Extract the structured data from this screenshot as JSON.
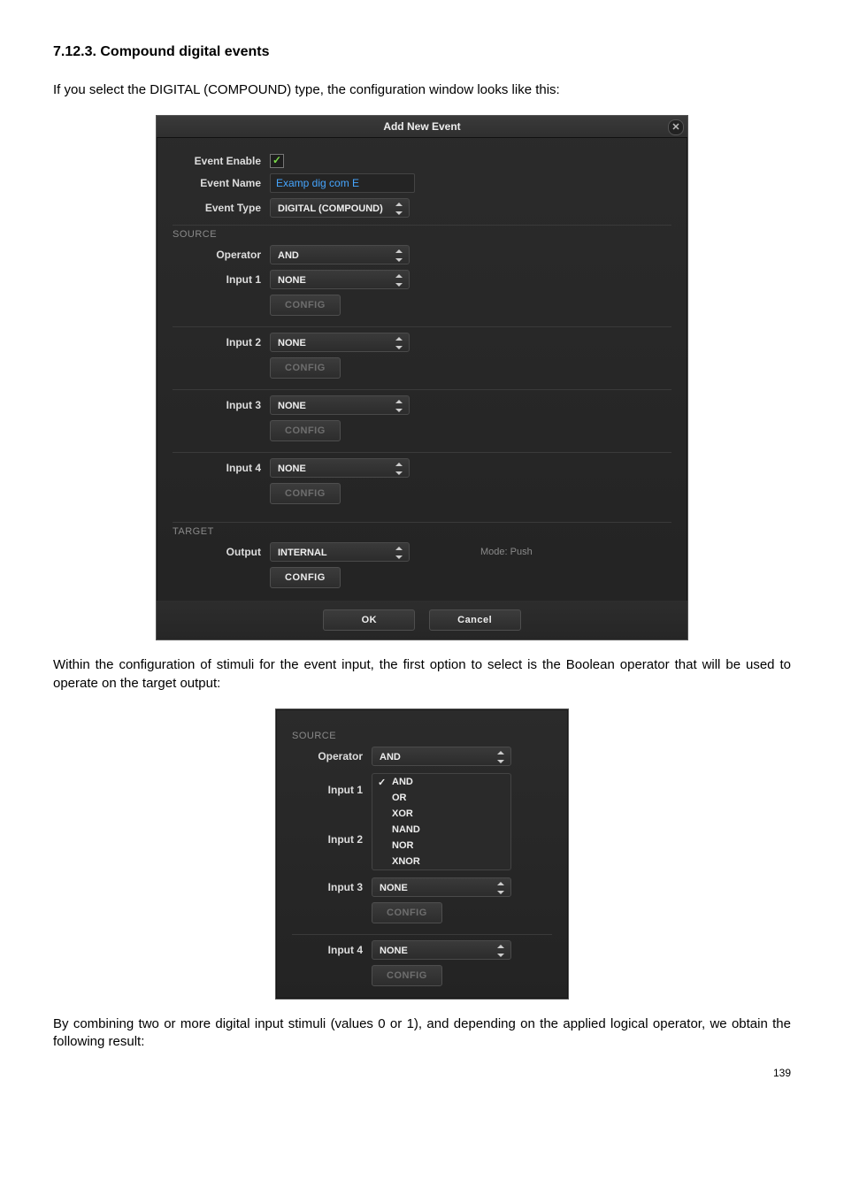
{
  "doc": {
    "heading": "7.12.3. Compound digital events",
    "para1": "If you select the DIGITAL (COMPOUND) type, the configuration window looks like this:",
    "para2": "Within the configuration of stimuli for the event input, the first option to select is the Boolean operator that will be used to operate on the target output:",
    "para3": "By combining two or more digital input stimuli (values 0 or 1), and depending on the applied logical operator, we obtain the following result:",
    "pageNumber": "139"
  },
  "dlg": {
    "title": "Add New Event",
    "eventEnableLabel": "Event Enable",
    "eventNameLabel": "Event Name",
    "eventNameValue": "Examp dig com E",
    "eventTypeLabel": "Event Type",
    "eventTypeValue": "DIGITAL (COMPOUND)",
    "sourceLabel": "SOURCE",
    "operatorLabel": "Operator",
    "operatorValue": "AND",
    "inputs": [
      {
        "label": "Input 1",
        "value": "NONE",
        "config": "CONFIG"
      },
      {
        "label": "Input 2",
        "value": "NONE",
        "config": "CONFIG"
      },
      {
        "label": "Input 3",
        "value": "NONE",
        "config": "CONFIG"
      },
      {
        "label": "Input 4",
        "value": "NONE",
        "config": "CONFIG"
      }
    ],
    "targetLabel": "TARGET",
    "outputLabel": "Output",
    "outputValue": "INTERNAL",
    "outputConfig": "CONFIG",
    "modeText": "Mode: Push",
    "ok": "OK",
    "cancel": "Cancel"
  },
  "dd": {
    "sourceLabel": "SOURCE",
    "operatorLabel": "Operator",
    "operatorValue": "AND",
    "input1Label": "Input 1",
    "input2Label": "Input 2",
    "options": [
      "AND",
      "OR",
      "XOR",
      "NAND",
      "NOR",
      "XNOR"
    ],
    "selected": "AND",
    "input3Label": "Input 3",
    "input3Value": "NONE",
    "input4Label": "Input 4",
    "input4Value": "NONE",
    "config": "CONFIG"
  }
}
